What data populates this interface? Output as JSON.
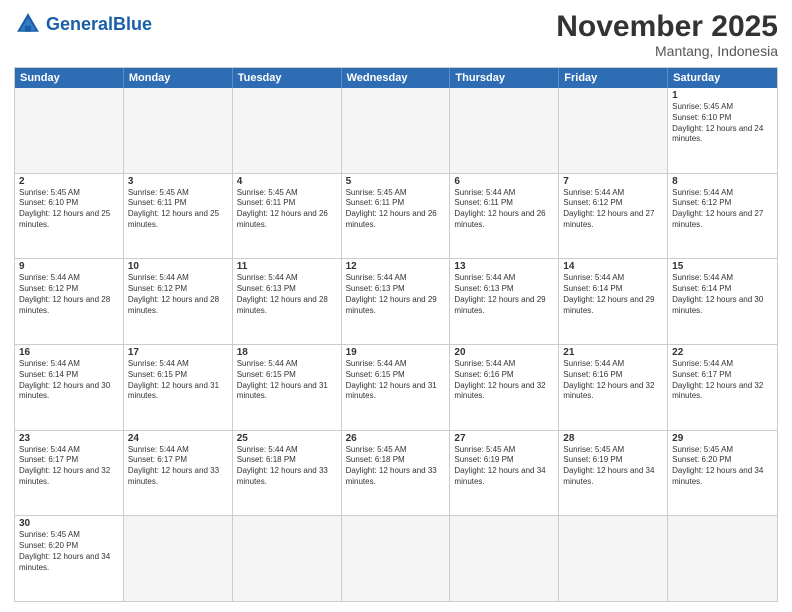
{
  "header": {
    "logo_general": "General",
    "logo_blue": "Blue",
    "month_title": "November 2025",
    "subtitle": "Mantang, Indonesia"
  },
  "days_of_week": [
    "Sunday",
    "Monday",
    "Tuesday",
    "Wednesday",
    "Thursday",
    "Friday",
    "Saturday"
  ],
  "weeks": [
    [
      {
        "day": "",
        "info": "",
        "empty": true
      },
      {
        "day": "",
        "info": "",
        "empty": true
      },
      {
        "day": "",
        "info": "",
        "empty": true
      },
      {
        "day": "",
        "info": "",
        "empty": true
      },
      {
        "day": "",
        "info": "",
        "empty": true
      },
      {
        "day": "",
        "info": "",
        "empty": true
      },
      {
        "day": "1",
        "sunrise": "Sunrise: 5:45 AM",
        "sunset": "Sunset: 6:10 PM",
        "daylight": "Daylight: 12 hours and 24 minutes."
      }
    ],
    [
      {
        "day": "2",
        "sunrise": "Sunrise: 5:45 AM",
        "sunset": "Sunset: 6:10 PM",
        "daylight": "Daylight: 12 hours and 25 minutes."
      },
      {
        "day": "3",
        "sunrise": "Sunrise: 5:45 AM",
        "sunset": "Sunset: 6:11 PM",
        "daylight": "Daylight: 12 hours and 25 minutes."
      },
      {
        "day": "4",
        "sunrise": "Sunrise: 5:45 AM",
        "sunset": "Sunset: 6:11 PM",
        "daylight": "Daylight: 12 hours and 26 minutes."
      },
      {
        "day": "5",
        "sunrise": "Sunrise: 5:45 AM",
        "sunset": "Sunset: 6:11 PM",
        "daylight": "Daylight: 12 hours and 26 minutes."
      },
      {
        "day": "6",
        "sunrise": "Sunrise: 5:44 AM",
        "sunset": "Sunset: 6:11 PM",
        "daylight": "Daylight: 12 hours and 26 minutes."
      },
      {
        "day": "7",
        "sunrise": "Sunrise: 5:44 AM",
        "sunset": "Sunset: 6:12 PM",
        "daylight": "Daylight: 12 hours and 27 minutes."
      },
      {
        "day": "8",
        "sunrise": "Sunrise: 5:44 AM",
        "sunset": "Sunset: 6:12 PM",
        "daylight": "Daylight: 12 hours and 27 minutes."
      }
    ],
    [
      {
        "day": "9",
        "sunrise": "Sunrise: 5:44 AM",
        "sunset": "Sunset: 6:12 PM",
        "daylight": "Daylight: 12 hours and 28 minutes."
      },
      {
        "day": "10",
        "sunrise": "Sunrise: 5:44 AM",
        "sunset": "Sunset: 6:12 PM",
        "daylight": "Daylight: 12 hours and 28 minutes."
      },
      {
        "day": "11",
        "sunrise": "Sunrise: 5:44 AM",
        "sunset": "Sunset: 6:13 PM",
        "daylight": "Daylight: 12 hours and 28 minutes."
      },
      {
        "day": "12",
        "sunrise": "Sunrise: 5:44 AM",
        "sunset": "Sunset: 6:13 PM",
        "daylight": "Daylight: 12 hours and 29 minutes."
      },
      {
        "day": "13",
        "sunrise": "Sunrise: 5:44 AM",
        "sunset": "Sunset: 6:13 PM",
        "daylight": "Daylight: 12 hours and 29 minutes."
      },
      {
        "day": "14",
        "sunrise": "Sunrise: 5:44 AM",
        "sunset": "Sunset: 6:14 PM",
        "daylight": "Daylight: 12 hours and 29 minutes."
      },
      {
        "day": "15",
        "sunrise": "Sunrise: 5:44 AM",
        "sunset": "Sunset: 6:14 PM",
        "daylight": "Daylight: 12 hours and 30 minutes."
      }
    ],
    [
      {
        "day": "16",
        "sunrise": "Sunrise: 5:44 AM",
        "sunset": "Sunset: 6:14 PM",
        "daylight": "Daylight: 12 hours and 30 minutes."
      },
      {
        "day": "17",
        "sunrise": "Sunrise: 5:44 AM",
        "sunset": "Sunset: 6:15 PM",
        "daylight": "Daylight: 12 hours and 31 minutes."
      },
      {
        "day": "18",
        "sunrise": "Sunrise: 5:44 AM",
        "sunset": "Sunset: 6:15 PM",
        "daylight": "Daylight: 12 hours and 31 minutes."
      },
      {
        "day": "19",
        "sunrise": "Sunrise: 5:44 AM",
        "sunset": "Sunset: 6:15 PM",
        "daylight": "Daylight: 12 hours and 31 minutes."
      },
      {
        "day": "20",
        "sunrise": "Sunrise: 5:44 AM",
        "sunset": "Sunset: 6:16 PM",
        "daylight": "Daylight: 12 hours and 32 minutes."
      },
      {
        "day": "21",
        "sunrise": "Sunrise: 5:44 AM",
        "sunset": "Sunset: 6:16 PM",
        "daylight": "Daylight: 12 hours and 32 minutes."
      },
      {
        "day": "22",
        "sunrise": "Sunrise: 5:44 AM",
        "sunset": "Sunset: 6:17 PM",
        "daylight": "Daylight: 12 hours and 32 minutes."
      }
    ],
    [
      {
        "day": "23",
        "sunrise": "Sunrise: 5:44 AM",
        "sunset": "Sunset: 6:17 PM",
        "daylight": "Daylight: 12 hours and 32 minutes."
      },
      {
        "day": "24",
        "sunrise": "Sunrise: 5:44 AM",
        "sunset": "Sunset: 6:17 PM",
        "daylight": "Daylight: 12 hours and 33 minutes."
      },
      {
        "day": "25",
        "sunrise": "Sunrise: 5:44 AM",
        "sunset": "Sunset: 6:18 PM",
        "daylight": "Daylight: 12 hours and 33 minutes."
      },
      {
        "day": "26",
        "sunrise": "Sunrise: 5:45 AM",
        "sunset": "Sunset: 6:18 PM",
        "daylight": "Daylight: 12 hours and 33 minutes."
      },
      {
        "day": "27",
        "sunrise": "Sunrise: 5:45 AM",
        "sunset": "Sunset: 6:19 PM",
        "daylight": "Daylight: 12 hours and 34 minutes."
      },
      {
        "day": "28",
        "sunrise": "Sunrise: 5:45 AM",
        "sunset": "Sunset: 6:19 PM",
        "daylight": "Daylight: 12 hours and 34 minutes."
      },
      {
        "day": "29",
        "sunrise": "Sunrise: 5:45 AM",
        "sunset": "Sunset: 6:20 PM",
        "daylight": "Daylight: 12 hours and 34 minutes."
      }
    ],
    [
      {
        "day": "30",
        "sunrise": "Sunrise: 5:45 AM",
        "sunset": "Sunset: 6:20 PM",
        "daylight": "Daylight: 12 hours and 34 minutes."
      },
      {
        "day": "",
        "info": "",
        "empty": true
      },
      {
        "day": "",
        "info": "",
        "empty": true
      },
      {
        "day": "",
        "info": "",
        "empty": true
      },
      {
        "day": "",
        "info": "",
        "empty": true
      },
      {
        "day": "",
        "info": "",
        "empty": true
      },
      {
        "day": "",
        "info": "",
        "empty": true
      }
    ]
  ]
}
